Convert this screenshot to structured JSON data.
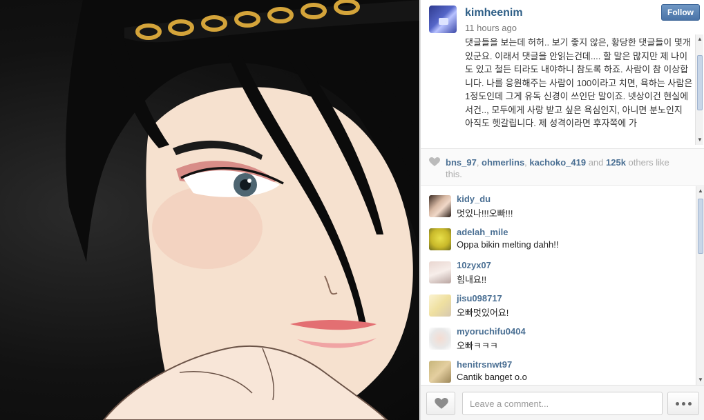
{
  "post": {
    "username": "kimheenim",
    "time_ago": "11 hours ago",
    "follow_label": "Follow",
    "caption": "댓글들을 보는데 허허.. 보기 좋지 않은, 황당한 댓글들이 몇개 있군요. 이래서 댓글을 안읽는건데.... 할 말은 많지만 제 나이도 있고 철든 티라도 내야하니 참도록 하죠. 사람이 참 이상합니다. 나를 응원해주는 사람이 100이라고 치면, 욕하는 사람은 1정도인데 그게 유독 신경이 쓰인단 말이죠. 넷상이건 현실에서건.., 모두에게 사랑 받고 싶은 욕심인지, 아니면 분노인지 아직도 헷갈립니다. 제 성격이라면 후자쪽에 가"
  },
  "likes": {
    "users": [
      "bns_97",
      "ohmerlins",
      "kachoko_419"
    ],
    "sep1": ", ",
    "sep2": ", ",
    "and_text": " and ",
    "count": "125k",
    "suffix": " others like this."
  },
  "comments": [
    {
      "user": "kidy_du",
      "text": "멋있나!!!오빠!!!"
    },
    {
      "user": "adelah_mile",
      "text": "Oppa bikin melting dahh!!"
    },
    {
      "user": "10zyx07",
      "text": "힘내요!!"
    },
    {
      "user": "jisu098717",
      "text": "오빠멋있어요!"
    },
    {
      "user": "myoruchifu0404",
      "text": "오빠ㅋㅋㅋ"
    },
    {
      "user": "henitrsnwt97",
      "text": "Cantik banget o.o"
    }
  ],
  "footer": {
    "comment_placeholder": "Leave a comment..."
  },
  "icons": {
    "like": "heart-icon",
    "more": "ellipsis-icon",
    "scroll_up": "arrow-up-icon",
    "scroll_down": "arrow-down-icon"
  },
  "colors": {
    "link": "#4a6f93",
    "username": "#2e5e86",
    "follow_button": "#4a74a8"
  }
}
